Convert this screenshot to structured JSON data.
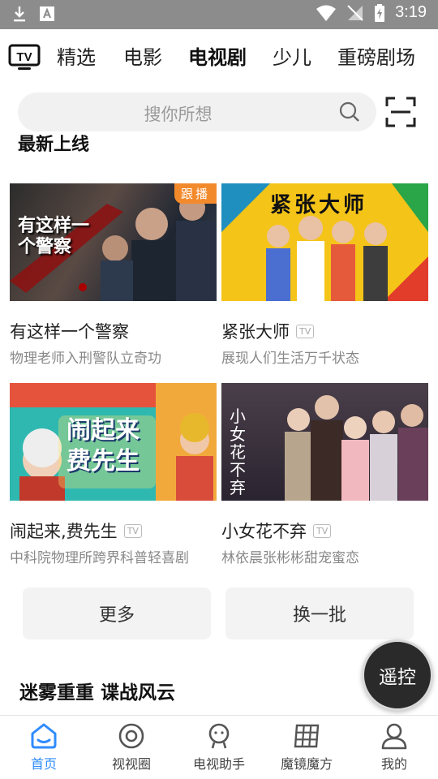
{
  "status_bar": {
    "time": "3:19"
  },
  "nav": {
    "logo_text": "TV",
    "tabs": [
      {
        "label": "精选"
      },
      {
        "label": "电影"
      },
      {
        "label": "电视剧",
        "active": true
      },
      {
        "label": "少儿"
      },
      {
        "label": "重磅剧场"
      }
    ]
  },
  "search": {
    "placeholder": "搜你所想"
  },
  "section1": {
    "title": "最新上线"
  },
  "cards": [
    {
      "title": "有这样一个警察",
      "subtitle": "物理老师入刑警队立奇功",
      "badge": "跟播",
      "overlay_text": "有这样一个警察"
    },
    {
      "title": "紧张大师",
      "subtitle": "展现人们生活万千状态",
      "tv_badge": "TV",
      "overlay_text": "紧张大师"
    },
    {
      "title": "闹起来,费先生",
      "subtitle": "中科院物理所跨界科普轻喜剧",
      "tv_badge": "TV",
      "overlay_text": "闹起来费先生"
    },
    {
      "title": "小女花不弃",
      "subtitle": "林依晨张彬彬甜宠蜜恋",
      "tv_badge": "TV",
      "overlay_text": "小女花不弃"
    }
  ],
  "buttons": {
    "more": "更多",
    "refresh": "换一批"
  },
  "section2": {
    "title": "迷雾重重 谍战风云"
  },
  "remote": {
    "label": "遥控"
  },
  "bottom_nav": [
    {
      "label": "首页",
      "icon": "home-icon",
      "active": true
    },
    {
      "label": "视视圈",
      "icon": "circle-icon"
    },
    {
      "label": "电视助手",
      "icon": "assistant-icon"
    },
    {
      "label": "魔镜魔方",
      "icon": "cube-grid-icon"
    },
    {
      "label": "我的",
      "icon": "profile-icon"
    }
  ],
  "colors": {
    "accent": "#2f8cff",
    "badge": "#f28a2c",
    "status_bar": "#8c8c8c"
  }
}
